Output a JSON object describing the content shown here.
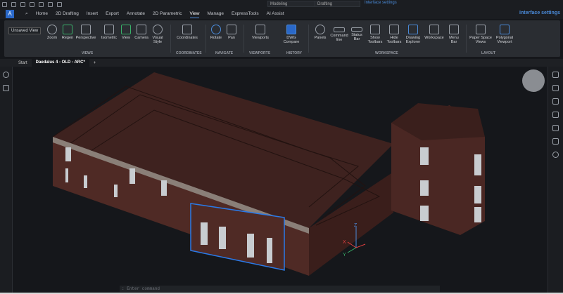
{
  "quick_access": {
    "workspace": "Modeling",
    "profile": "Drafting",
    "interface_settings": "Interface settings"
  },
  "menu": {
    "tabs": [
      "Home",
      "2D Drafting",
      "Insert",
      "Export",
      "Annotate",
      "2D Parametric",
      "View",
      "Manage",
      "ExpressTools",
      "AI Assist"
    ],
    "active": "View",
    "interface_settings": "Interface settings"
  },
  "ribbon": {
    "unsaved_view": "Unsaved View",
    "buttons": [
      {
        "label": "Zoom",
        "icon": "zoom-icon"
      },
      {
        "label": "Regen",
        "icon": "regen-icon"
      },
      {
        "label": "Perspective",
        "icon": "perspective-icon"
      },
      {
        "label": "Isometric",
        "icon": "isometric-icon"
      },
      {
        "label": "View",
        "icon": "view-icon"
      },
      {
        "label": "Camera",
        "icon": "camera-icon"
      },
      {
        "label": "Visual Style",
        "icon": "visual-style-icon"
      },
      {
        "label": "Coordinates",
        "icon": "coordinates-icon"
      },
      {
        "label": "Rotate",
        "icon": "rotate-icon"
      },
      {
        "label": "Pan",
        "icon": "pan-icon"
      },
      {
        "label": "Viewports",
        "icon": "viewports-icon"
      },
      {
        "label": "DWG Compare",
        "icon": "dwg-compare-icon"
      },
      {
        "label": "Panels",
        "icon": "panels-icon"
      },
      {
        "label": "Command line",
        "icon": "command-line-icon"
      },
      {
        "label": "Status Bar",
        "icon": "status-bar-icon"
      },
      {
        "label": "Show Toolbars",
        "icon": "show-toolbars-icon"
      },
      {
        "label": "Hide Toolbars",
        "icon": "hide-toolbars-icon"
      },
      {
        "label": "Drawing Explorer",
        "icon": "drawing-explorer-icon"
      },
      {
        "label": "Workspace",
        "icon": "workspace-icon"
      },
      {
        "label": "Menu Bar",
        "icon": "menu-bar-icon"
      },
      {
        "label": "Paper Space Views",
        "icon": "paper-space-icon"
      },
      {
        "label": "Polygonal Viewport",
        "icon": "polygonal-viewport-icon"
      }
    ],
    "groups": [
      "VIEWS",
      "COORDINATES",
      "NAVIGATE",
      "VIEWPORTS",
      "HISTORY",
      "WORKSPACE",
      "LAYOUT"
    ]
  },
  "doc_tabs": [
    "Start",
    "Daedalus 4 - OLD - ARC*"
  ],
  "axes": {
    "x": "X",
    "y": "Y",
    "z": "Z"
  },
  "command": {
    "placeholder": ": Enter command"
  }
}
